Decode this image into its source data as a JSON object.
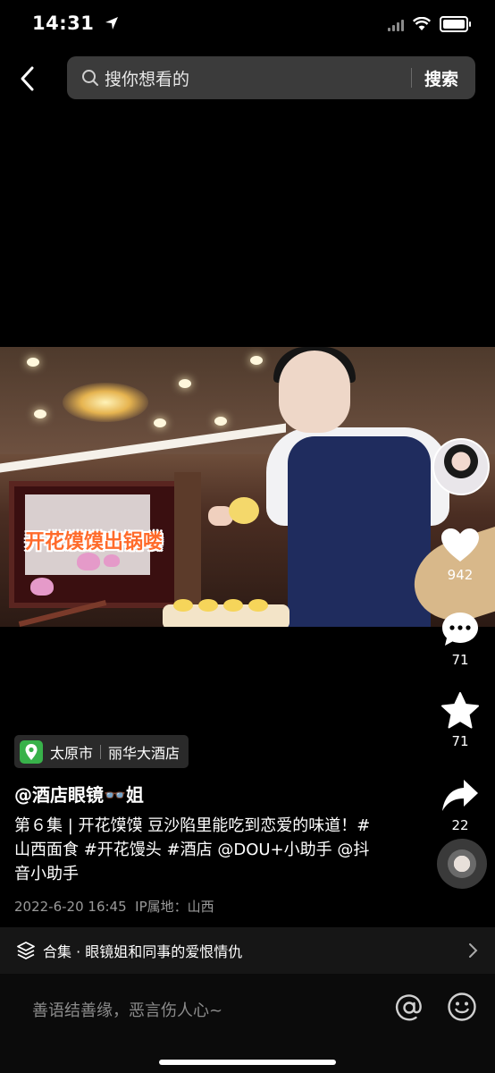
{
  "status_bar": {
    "time": "14:31"
  },
  "search": {
    "placeholder": "搜你想看的",
    "button": "搜索"
  },
  "video": {
    "caption": "开花馍馍出锅喽"
  },
  "actions": {
    "likes": "942",
    "comments": "71",
    "favorites": "71",
    "shares": "22"
  },
  "location": {
    "city": "太原市",
    "place": "丽华大酒店"
  },
  "post": {
    "author": "@酒店眼镜👓姐",
    "description": "第６集 | 开花馍馍 豆沙陷里能吃到恋爱的味道！#山西面食 #开花馒头 #酒店 @DOU+小助手 @抖音小助手",
    "meta": "2022-6-20 16:45  IP属地：山西"
  },
  "collection": {
    "label": "合集 · 眼镜姐和同事的爱恨情仇"
  },
  "comment": {
    "placeholder": "善语结善缘，恶言伤人心~"
  },
  "icons": [
    "location-arrow-icon",
    "signal-icon",
    "wifi-icon",
    "battery-icon",
    "back-icon",
    "search-icon",
    "heart-icon",
    "comment-icon",
    "star-icon",
    "share-icon",
    "music-disc-icon",
    "location-pin-icon",
    "collection-icon",
    "chevron-right-icon",
    "at-icon",
    "emoji-icon"
  ],
  "colors": {
    "caption": "#ff6b2b",
    "location_pin": "#38b24a",
    "meta_text": "#9a9a9a"
  }
}
